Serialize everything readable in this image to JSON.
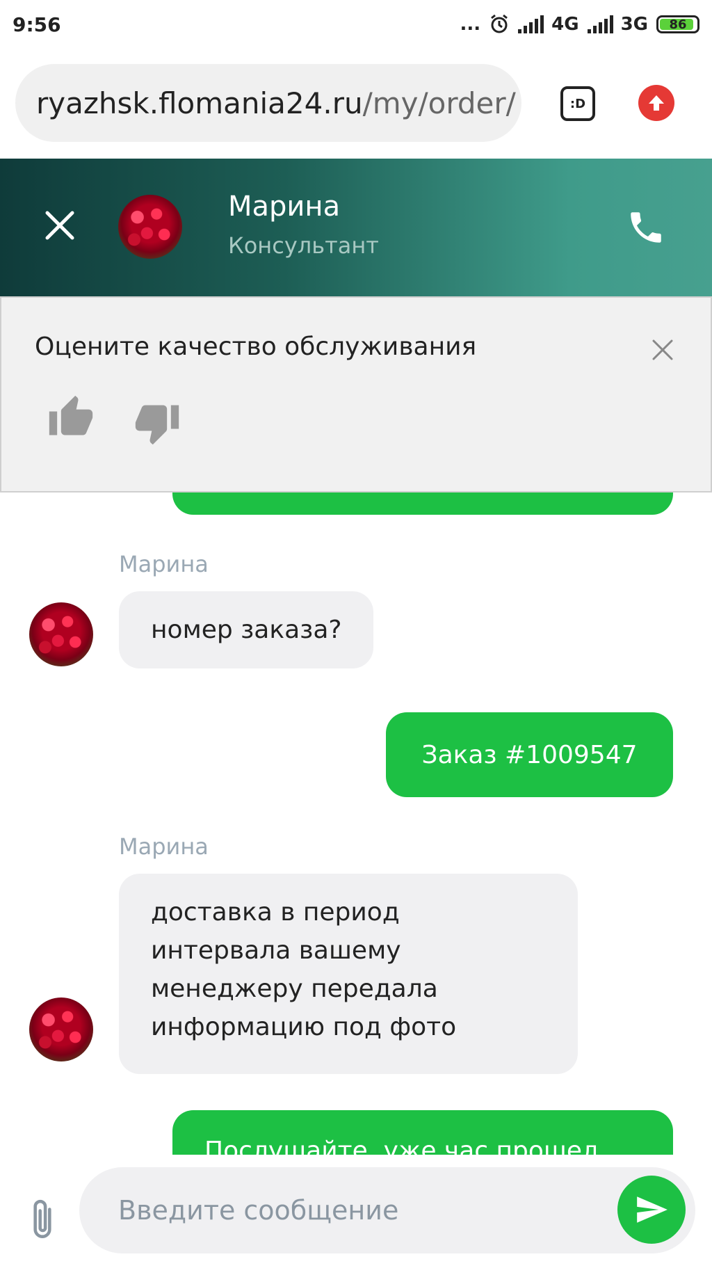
{
  "status_bar": {
    "time": "9:56",
    "dots": "...",
    "network1": "4G",
    "network2": "3G",
    "battery": "86"
  },
  "browser": {
    "url_host": "ryazhsk.flomania24.ru",
    "url_path": "/my/order/",
    "reader_label": ":D"
  },
  "chat_header": {
    "name": "Марина",
    "role": "Консультант"
  },
  "rating": {
    "title": "Оцените качество обслуживания"
  },
  "messages": [
    {
      "type": "outgoing",
      "text": ""
    },
    {
      "type": "incoming",
      "sender": "Марина",
      "text": "номер заказа?"
    },
    {
      "type": "outgoing",
      "text": "Заказ #1009547"
    },
    {
      "type": "incoming",
      "sender": "Марина",
      "lines": [
        "доставка в период",
        "интервала вашему",
        "менеджеру передала",
        "информацию под фото"
      ]
    },
    {
      "type": "outgoing",
      "text": "Послушайте, уже час прошел"
    }
  ],
  "composer": {
    "placeholder": "Введите сообщение"
  },
  "colors": {
    "accent_green": "#1dc044",
    "header_dark": "#0f3b3a",
    "header_light": "#47a08f",
    "upload_red": "#e53935"
  },
  "icons": [
    "close-icon",
    "phone-icon",
    "thumbs-up-icon",
    "thumbs-down-icon",
    "paperclip-icon",
    "send-icon",
    "upload-icon",
    "alarm-icon"
  ]
}
